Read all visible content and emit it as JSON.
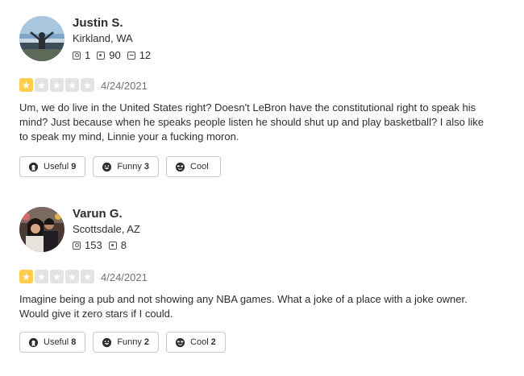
{
  "reviews": [
    {
      "user": {
        "name": "Justin S.",
        "location": "Kirkland, WA",
        "friends": "1",
        "reviews": "90",
        "photos": "12"
      },
      "rating": 1,
      "date": "4/24/2021",
      "text_lines": [
        "Um, we do live in the United States right? Doesn't LeBron have the constitutional right to speak his",
        "mind?  Just because when he speaks people listen he should shut up and play basketball? I also like",
        "to speak my mind, Linnie your a fucking moron."
      ],
      "votes": {
        "useful_label": "Useful",
        "useful_count": "9",
        "funny_label": "Funny",
        "funny_count": "3",
        "cool_label": "Cool",
        "cool_count": ""
      }
    },
    {
      "user": {
        "name": "Varun G.",
        "location": "Scottsdale, AZ",
        "friends": "153",
        "reviews": "8"
      },
      "rating": 1,
      "date": "4/24/2021",
      "text_lines": [
        "Imagine being a pub and not showing any NBA games. What a joke of a place with a joke owner.",
        "Would give it zero stars if I could."
      ],
      "votes": {
        "useful_label": "Useful",
        "useful_count": "8",
        "funny_label": "Funny",
        "funny_count": "2",
        "cool_label": "Cool",
        "cool_count": "2"
      }
    }
  ],
  "icons": {
    "star": "star-icon",
    "friends": "friends-icon",
    "reviews": "review-count-icon",
    "photos": "photo-count-icon",
    "useful": "useful-icon",
    "funny": "funny-icon",
    "cool": "cool-icon"
  },
  "colors": {
    "star_on": "#ffcc4b",
    "star_off": "#e3e3e3",
    "text": "#2d2e2f",
    "muted": "#6e7072",
    "border": "#c8c9ca"
  }
}
